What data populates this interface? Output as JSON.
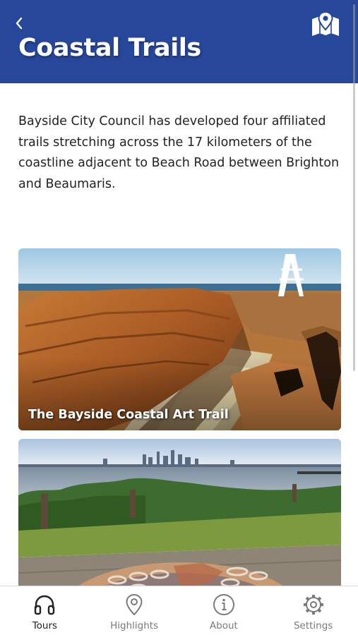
{
  "header": {
    "title": "Coastal Trails",
    "back_icon": "chevron-left-icon",
    "map_icon": "map-pin-icon",
    "background_color": "#27479b"
  },
  "intro": {
    "text": "Bayside City Council has developed four affiliated trails stretching across the 17 kilometers of the coastline adjacent to Beach Road between Brighton and Beaumaris."
  },
  "trails": [
    {
      "label": "The Bayside Coastal Art Trail"
    },
    {
      "label": ""
    }
  ],
  "tabs": [
    {
      "label": "Tours",
      "icon": "headphones-icon",
      "active": true
    },
    {
      "label": "Highlights",
      "icon": "location-pin-icon",
      "active": false
    },
    {
      "label": "About",
      "icon": "info-icon",
      "active": false
    },
    {
      "label": "Settings",
      "icon": "gear-icon",
      "active": false
    }
  ],
  "colors": {
    "active_tab": "#222222",
    "inactive_tab": "#7a7a7a"
  }
}
